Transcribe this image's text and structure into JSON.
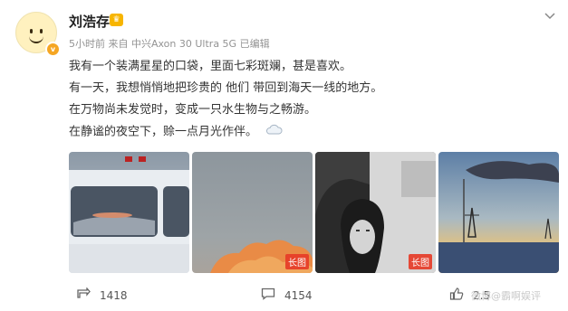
{
  "user": {
    "name": "刘浩存",
    "meta": "5小时前  来自 中兴Axon 30 Ultra 5G  已编辑"
  },
  "post": {
    "lines": [
      "我有一个装满星星的口袋，里面七彩斑斓，甚是喜欢。",
      "有一天，我想悄悄地把珍贵的 他们 带回到海天一线的地方。",
      "在万物尚未发觉时，变成一只水生物与之畅游。",
      "在静谧的夜空下，赊一点月光作伴。"
    ]
  },
  "images": [
    {
      "badge": ""
    },
    {
      "badge": "长图"
    },
    {
      "badge": "长图"
    },
    {
      "badge": ""
    }
  ],
  "actions": {
    "repost": "1418",
    "comment": "4154",
    "like": "2.5"
  },
  "watermark": "微博@霸啊娱评",
  "icons": {
    "avatar": "smiley-avatar",
    "verified": "verified-badge-icon",
    "member": "crown-icon",
    "menu": "chevron-down-icon",
    "weather": "cloud-icon",
    "repost": "repost-icon",
    "comment": "comment-icon",
    "like": "like-icon"
  }
}
